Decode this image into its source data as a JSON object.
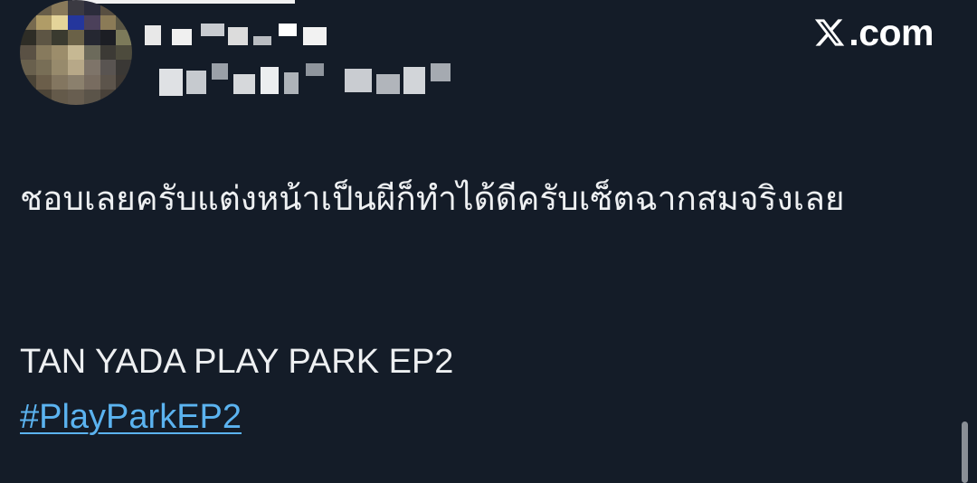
{
  "watermark": {
    "brand": "X.com",
    "brand_suffix": ".com"
  },
  "post": {
    "author_name_hidden": true,
    "author_handle_hidden": true,
    "text": "ชอบเลยครับแต่งหน้าเป็นผีก็ทำได้ดีครับเซ็ตฉากสมจริงเลย",
    "title_line": "TAN YADA PLAY PARK EP2",
    "hashtag": "#PlayParkEP2"
  },
  "colors": {
    "background": "#141c28",
    "text": "#eef0f2",
    "link": "#5bb3f0",
    "brand": "#ffffff"
  },
  "icons": {
    "avatar": "pixelated-avatar",
    "logo": "x-logo-icon"
  }
}
